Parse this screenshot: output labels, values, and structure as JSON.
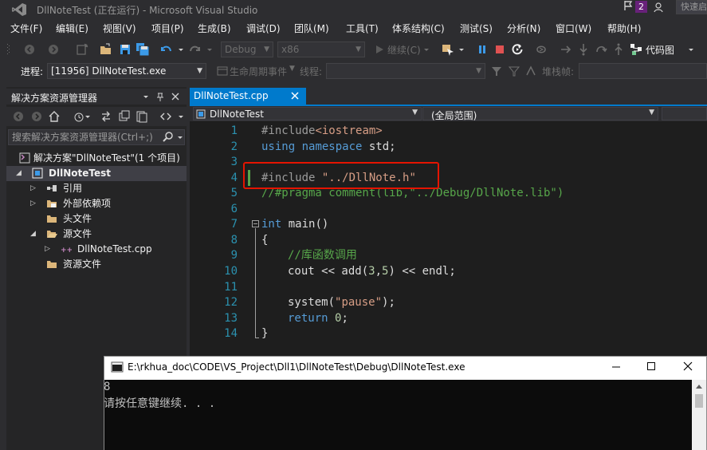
{
  "window": {
    "title": "DllNoteTest (正在运行) - Microsoft Visual Studio",
    "notification_count": "2",
    "quick_launch": "快速启"
  },
  "menu": [
    "文件(F)",
    "编辑(E)",
    "视图(V)",
    "项目(P)",
    "生成(B)",
    "调试(D)",
    "团队(M)",
    "工具(T)",
    "体系结构(C)",
    "测试(S)",
    "分析(N)",
    "窗口(W)",
    "帮助(H)"
  ],
  "toolbar": {
    "config": "Debug",
    "platform": "x86",
    "continue_label": "继续(C)",
    "codemap_label": "代码图"
  },
  "toolbar2": {
    "process_label": "进程:",
    "process_value": "[11956] DllNoteTest.exe",
    "lifecycle_label": "生命周期事件",
    "thread_label": "线程:",
    "stackframe_label": "堆栈帧:"
  },
  "solution_explorer": {
    "title": "解决方案资源管理器",
    "search_placeholder": "搜索解决方案资源管理器(Ctrl+;)",
    "solution": "解决方案\"DllNoteTest\"(1 个项目)",
    "project": "DllNoteTest",
    "items": {
      "references": "引用",
      "external_deps": "外部依赖项",
      "headers": "头文件",
      "sources": "源文件",
      "cpp_file": "DllNoteTest.cpp",
      "resources": "资源文件"
    }
  },
  "editor": {
    "tab_name": "DllNoteTest.cpp",
    "nav_left": "DllNoteTest",
    "nav_right": "(全局范围)",
    "line_numbers": [
      "1",
      "2",
      "3",
      "4",
      "5",
      "6",
      "7",
      "8",
      "9",
      "10",
      "11",
      "12",
      "13",
      "14"
    ],
    "code": {
      "l1_dir": "#include",
      "l1_arg": "<iostream>",
      "l2_kw1": "using",
      "l2_kw2": "namespace",
      "l2_rest": " std;",
      "l4_dir": "#include",
      "l4_str": "\"../DllNote.h\"",
      "l5_comment": "//#pragma comment(lib,\"../Debug/DllNote.lib\")",
      "l7_kw": "int",
      "l7_rest": " main()",
      "l8": "{",
      "l9_comment": "//库函数调用",
      "l10_a": "cout << add(",
      "l10_n1": "3",
      "l10_b": ",",
      "l10_n2": "5",
      "l10_c": ") << endl;",
      "l12_a": "system(",
      "l12_str": "\"pause\"",
      "l12_b": ");",
      "l13_kw": "return",
      "l13_num": "0",
      "l13_rest": ";",
      "l14": "}"
    }
  },
  "console": {
    "title": "E:\\rkhua_doc\\CODE\\VS_Project\\Dll1\\DllNoteTest\\Debug\\DllNoteTest.exe",
    "output_line1": "8",
    "output_line2": "请按任意键继续. . ."
  },
  "colors": {
    "accent": "#007acc",
    "highlight_box": "#e51400",
    "badge": "#68217a"
  }
}
